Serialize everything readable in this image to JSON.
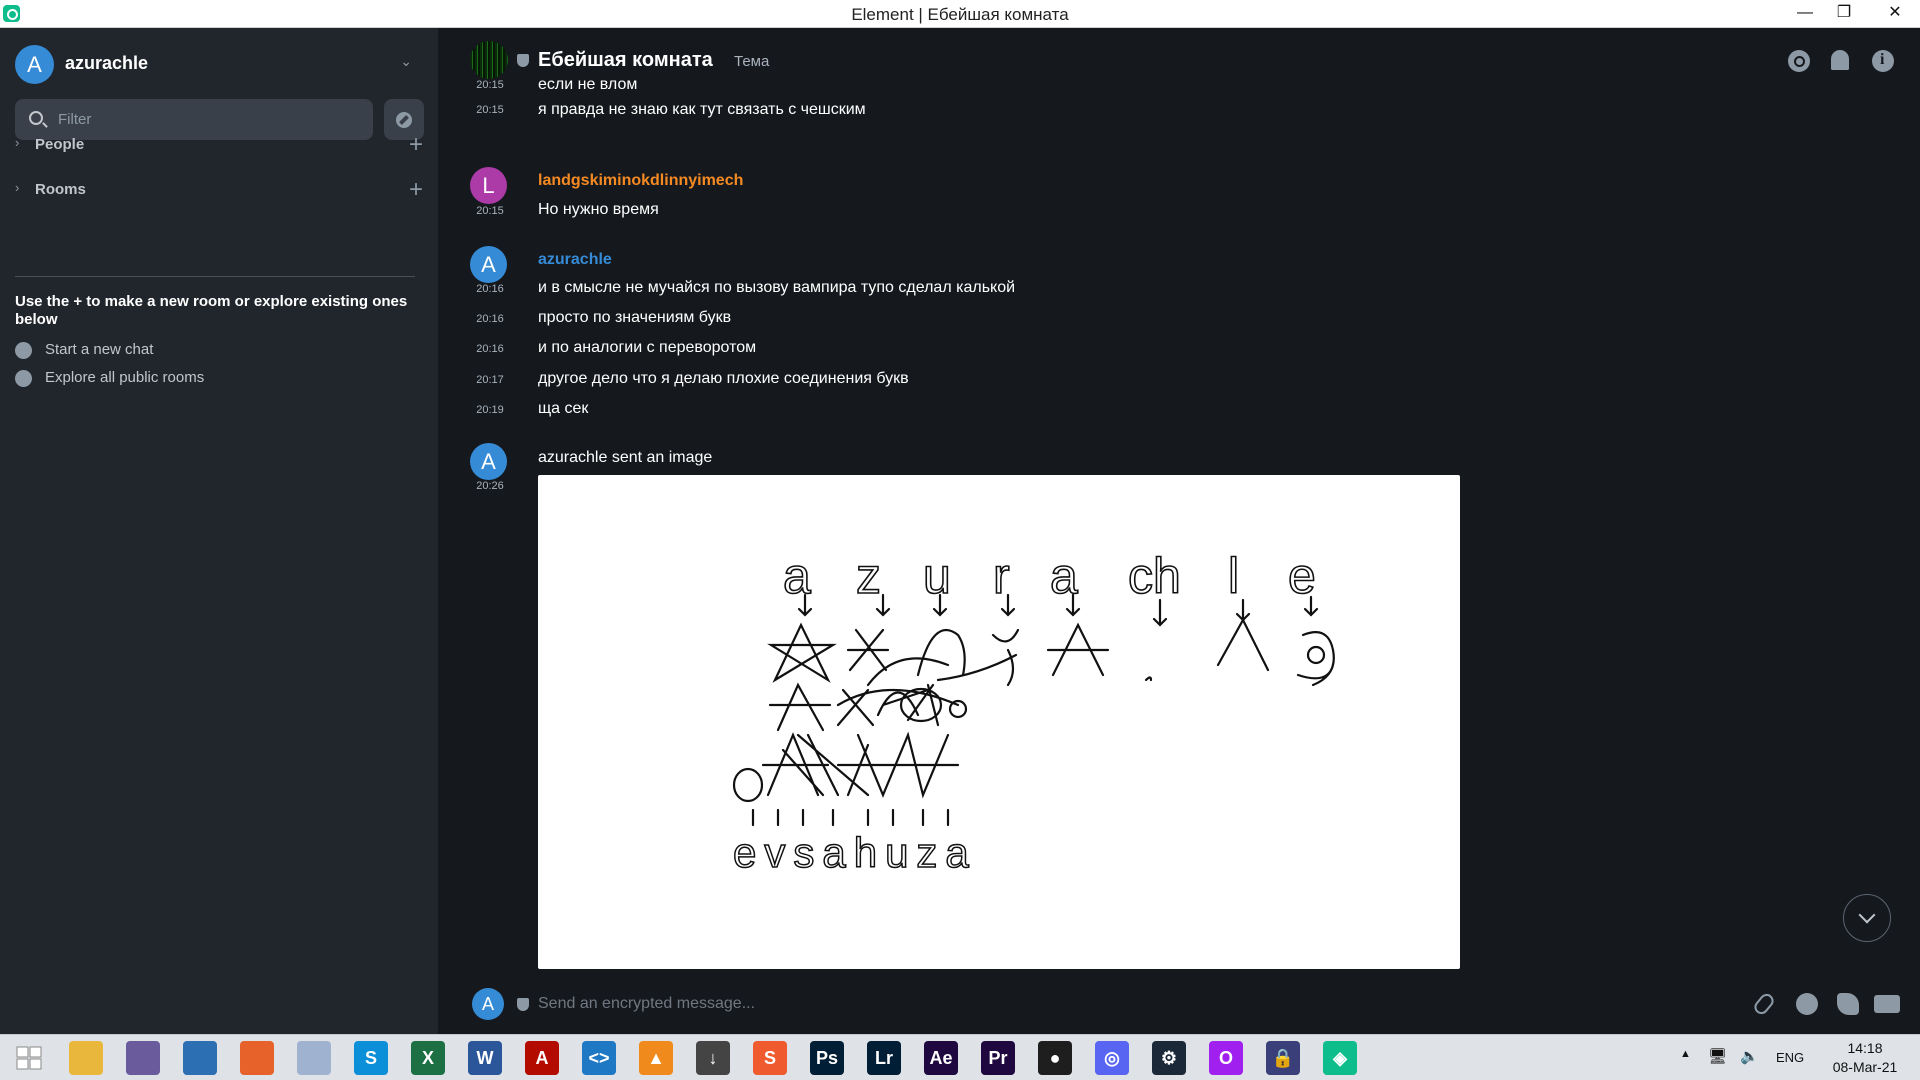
{
  "window": {
    "title": "Element | Ебейшая комната",
    "minimize": "—",
    "maximize": "❐",
    "close": "✕"
  },
  "left_panel": {
    "user_initial": "A",
    "username": "azurachle",
    "chevron": "⌄",
    "filter_placeholder": "Filter",
    "sections": [
      {
        "arrow": "›",
        "label": "People",
        "add": "+"
      },
      {
        "arrow": "›",
        "label": "Rooms",
        "add": "+"
      }
    ],
    "help_text": "Use the + to make a new room or explore existing ones below",
    "links": [
      {
        "icon": "chat-bubble-icon",
        "label": "Start a new chat"
      },
      {
        "icon": "compass-icon",
        "label": "Explore all public rooms"
      }
    ]
  },
  "room": {
    "name": "Ебейшая комната",
    "topic": "Тема"
  },
  "messages": [
    {
      "time": "20:15",
      "text": "если не влом"
    },
    {
      "time": "20:15",
      "text": "я правда не знаю как тут связать с чешским"
    },
    {
      "sender": "landgskiminokdlinnyimech",
      "sender_initial": "L",
      "sender_color": "#ac3ba8",
      "name_color": "#f58a22",
      "time": "20:15",
      "text": "Но нужно время"
    },
    {
      "sender": "azurachle",
      "sender_initial": "A",
      "sender_color": "#368bd6",
      "name_color": "#368bd6",
      "time": "20:16",
      "text": "и в смысле не мучайся по вызову вампира тупо сделал калькой"
    },
    {
      "time": "20:16",
      "text": "просто по значениям букв"
    },
    {
      "time": "20:16",
      "text": "и по аналогии с переворотом"
    },
    {
      "time": "20:17",
      "text": "другое дело что я делаю плохие соединения букв"
    },
    {
      "time": "20:19",
      "text": "ща сек"
    },
    {
      "sender_initial": "A",
      "sender_color": "#368bd6",
      "time": "20:26",
      "text": "azurachle sent an image"
    }
  ],
  "image_sketch": {
    "row1": [
      "a",
      "z",
      "u",
      "r",
      "a",
      "ch",
      "l",
      "e"
    ],
    "row4": "evsahuza"
  },
  "composer": {
    "placeholder": "Send an encrypted message...",
    "user_initial": "A"
  },
  "taskbar": {
    "apps": [
      {
        "name": "start",
        "label": "",
        "color": "#dfe3e8"
      },
      {
        "name": "file-explorer",
        "label": "",
        "color": "#e9b73c"
      },
      {
        "name": "torrent",
        "label": "",
        "color": "#6a5b9c"
      },
      {
        "name": "browser",
        "label": "",
        "color": "#2c6fb3"
      },
      {
        "name": "firefox",
        "label": "",
        "color": "#e6622a"
      },
      {
        "name": "app-moon",
        "label": "",
        "color": "#9fb3d1"
      },
      {
        "name": "skype",
        "label": "S",
        "color": "#0a8fd8"
      },
      {
        "name": "excel",
        "label": "X",
        "color": "#1d7044"
      },
      {
        "name": "word",
        "label": "W",
        "color": "#2b579a"
      },
      {
        "name": "acrobat",
        "label": "A",
        "color": "#b30b00"
      },
      {
        "name": "vscode",
        "label": "<>",
        "color": "#1f78c4"
      },
      {
        "name": "vlc",
        "label": "▲",
        "color": "#f08a1c"
      },
      {
        "name": "download-manager",
        "label": "↓",
        "color": "#444444"
      },
      {
        "name": "sublime",
        "label": "S",
        "color": "#ef5a2e"
      },
      {
        "name": "photoshop",
        "label": "Ps",
        "color": "#001e36"
      },
      {
        "name": "lightroom",
        "label": "Lr",
        "color": "#001e36"
      },
      {
        "name": "after-effects",
        "label": "Ae",
        "color": "#1f0840"
      },
      {
        "name": "premiere",
        "label": "Pr",
        "color": "#1f0840"
      },
      {
        "name": "obs",
        "label": "●",
        "color": "#1e1e1e"
      },
      {
        "name": "discord",
        "label": "◎",
        "color": "#5865f2"
      },
      {
        "name": "steam",
        "label": "⚙",
        "color": "#1b2838"
      },
      {
        "name": "opera",
        "label": "O",
        "color": "#a020f0"
      },
      {
        "name": "vpn",
        "label": "🔒",
        "color": "#3a3f7a"
      },
      {
        "name": "element",
        "label": "◈",
        "color": "#0dbd8b"
      }
    ],
    "tray": {
      "up_arrow": "▲",
      "network": "🖥",
      "volume": "🔈",
      "lang": "ENG",
      "time": "14:18",
      "date": "08-Mar-21"
    }
  }
}
